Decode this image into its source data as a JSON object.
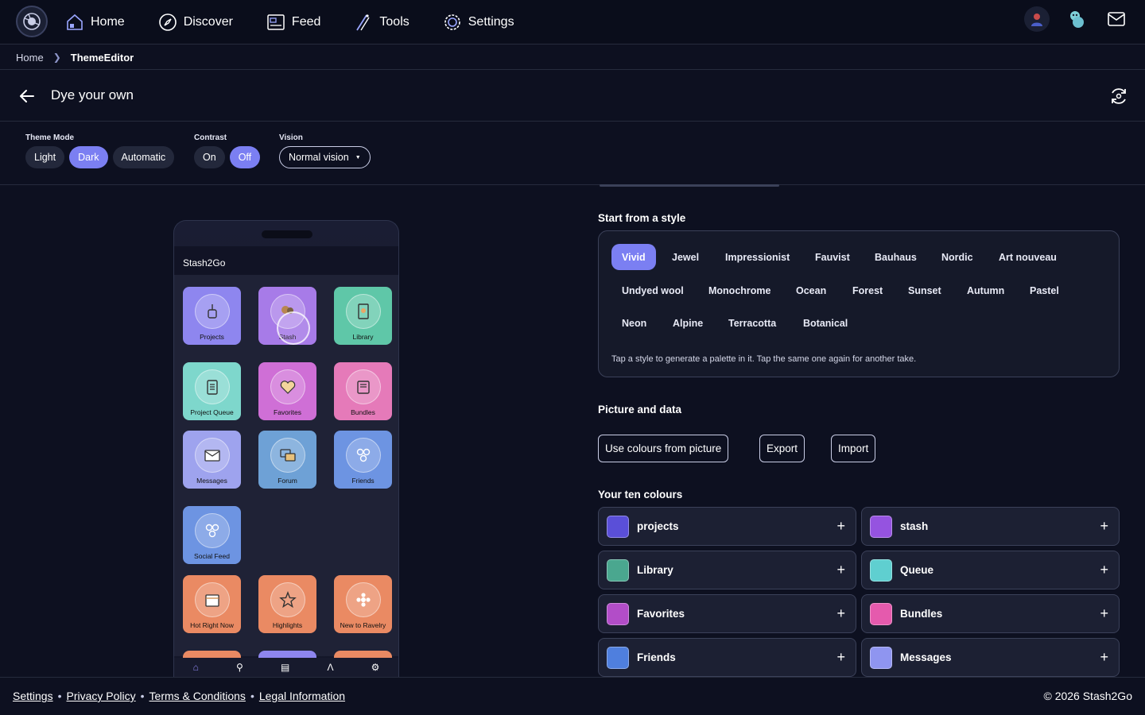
{
  "nav": {
    "items": [
      {
        "label": "Home",
        "icon": "home-icon"
      },
      {
        "label": "Discover",
        "icon": "compass-icon"
      },
      {
        "label": "Feed",
        "icon": "feed-icon"
      },
      {
        "label": "Tools",
        "icon": "tools-icon"
      },
      {
        "label": "Settings",
        "icon": "gear-icon"
      }
    ]
  },
  "breadcrumb": {
    "home": "Home",
    "current": "ThemeEditor"
  },
  "header": {
    "title": "Dye your own"
  },
  "controls": {
    "theme_mode": {
      "label": "Theme Mode",
      "options": [
        "Light",
        "Dark",
        "Automatic"
      ],
      "selected": "Dark"
    },
    "contrast": {
      "label": "Contrast",
      "options": [
        "On",
        "Off"
      ],
      "selected": "Off"
    },
    "vision": {
      "label": "Vision",
      "value": "Normal vision"
    }
  },
  "phone": {
    "app_name": "Stash2Go",
    "tiles": [
      {
        "label": "Projects",
        "color": "#8e86ef"
      },
      {
        "label": "Stash",
        "color": "#a77be8"
      },
      {
        "label": "Library",
        "color": "#5fc7a8"
      },
      {
        "label": "Project Queue",
        "color": "#7ed7cc"
      },
      {
        "label": "Favorites",
        "color": "#cf6fd6"
      },
      {
        "label": "Bundles",
        "color": "#e57ab9"
      },
      {
        "label": "Messages",
        "color": "#9ea3ee"
      },
      {
        "label": "Forum",
        "color": "#6ea1d6"
      },
      {
        "label": "Friends",
        "color": "#6d94e2"
      },
      {
        "label": "Social Feed",
        "color": "#6d94e2"
      },
      {
        "label": "Hot Right Now",
        "color": "#ea8a63"
      },
      {
        "label": "Highlights",
        "color": "#ea8a63"
      },
      {
        "label": "New to Ravelry",
        "color": "#ea8a63"
      }
    ]
  },
  "styles": {
    "title": "Start from a style",
    "chips": [
      "Vivid",
      "Jewel",
      "Impressionist",
      "Fauvist",
      "Bauhaus",
      "Nordic",
      "Art nouveau",
      "Undyed wool",
      "Monochrome",
      "Ocean",
      "Forest",
      "Sunset",
      "Autumn",
      "Pastel",
      "Neon",
      "Alpine",
      "Terracotta",
      "Botanical"
    ],
    "selected": "Vivid",
    "hint": "Tap a style to generate a palette in it. Tap the same one again for another take."
  },
  "picture": {
    "title": "Picture and data",
    "buttons": [
      "Use colours from picture",
      "Export",
      "Import"
    ]
  },
  "colours": {
    "title": "Your ten colours",
    "items": [
      {
        "name": "projects",
        "hex": "#5a4fd8"
      },
      {
        "name": "stash",
        "hex": "#9553e0"
      },
      {
        "name": "Library",
        "hex": "#4aa78f"
      },
      {
        "name": "Queue",
        "hex": "#5fcfd0"
      },
      {
        "name": "Favorites",
        "hex": "#b24dc8"
      },
      {
        "name": "Bundles",
        "hex": "#e55aad"
      },
      {
        "name": "Friends",
        "hex": "#4f7fde"
      },
      {
        "name": "Messages",
        "hex": "#8f95f0"
      }
    ]
  },
  "footer": {
    "links": [
      "Settings",
      "Privacy Policy",
      "Terms & Conditions",
      "Legal Information"
    ],
    "copyright": "© 2026 Stash2Go"
  }
}
